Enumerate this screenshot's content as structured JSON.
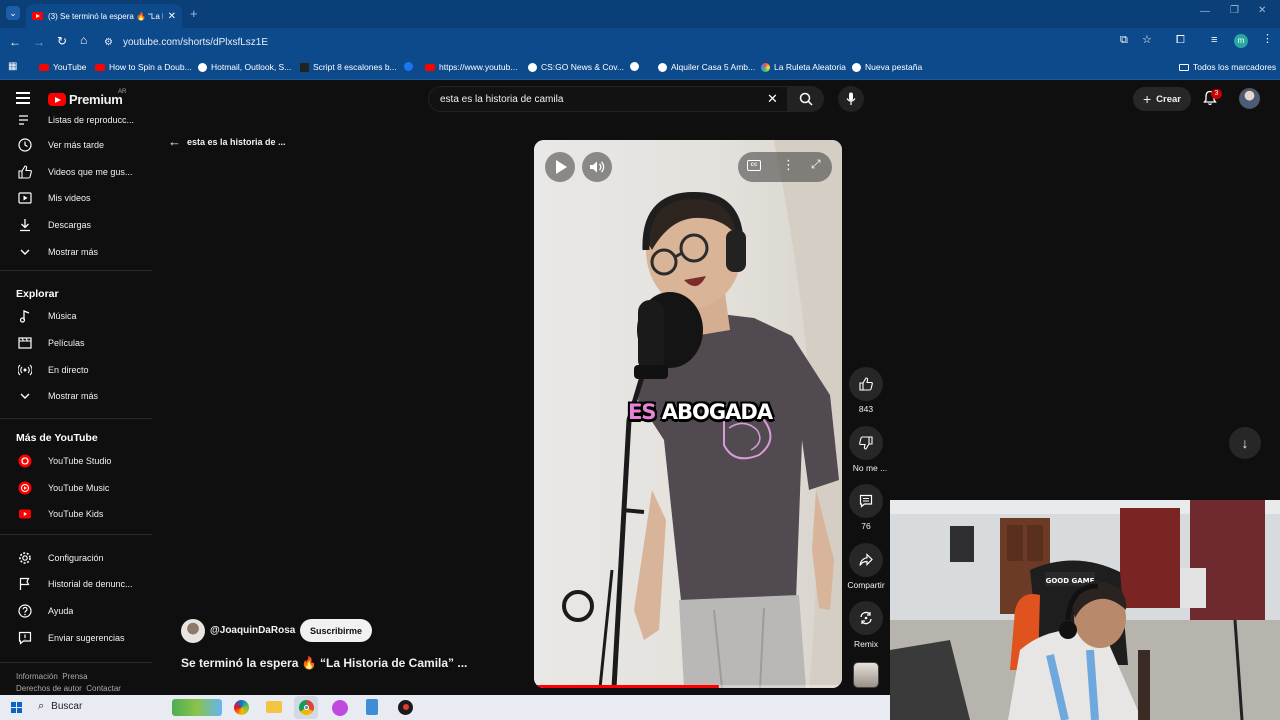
{
  "browser": {
    "tab_title": "(3) Se terminó la espera 🔥 “La H",
    "url": "youtube.com/shorts/dPlxsfLsz1E",
    "bookmarks": [
      {
        "label": "YouTube",
        "icon": "youtube-icon"
      },
      {
        "label": "How to Spin a Doub...",
        "icon": "youtube-icon"
      },
      {
        "label": "Hotmail, Outlook, S...",
        "icon": "globe-icon"
      },
      {
        "label": "Script 8 escalones b...",
        "icon": "site-icon"
      },
      {
        "label": "",
        "icon": "facebook-icon"
      },
      {
        "label": "https://www.youtub...",
        "icon": "youtube-icon"
      },
      {
        "label": "CS:GO News & Cov...",
        "icon": "globe-icon"
      },
      {
        "label": "",
        "icon": "globe-icon"
      },
      {
        "label": "Alquiler Casa 5 Amb...",
        "icon": "globe-icon"
      },
      {
        "label": "La Ruleta Aleatoria",
        "icon": "wheel-icon"
      },
      {
        "label": "Nueva pestaña",
        "icon": "globe-icon"
      }
    ],
    "all_bookmarks": "Todos los marcadores",
    "profile_initial": "m"
  },
  "header": {
    "logo": "Premium",
    "logo_country": "AR",
    "search_query": "esta es la historia de camila",
    "create_label": "Crear",
    "notification_count": "3"
  },
  "sidebar": {
    "top_items": [
      {
        "label": "Listas de reproducc...",
        "icon": "playlist-icon"
      },
      {
        "label": "Ver más tarde",
        "icon": "clock-icon"
      },
      {
        "label": "Videos que me gus...",
        "icon": "thumbs-up-icon"
      },
      {
        "label": "Mis videos",
        "icon": "video-icon"
      },
      {
        "label": "Descargas",
        "icon": "download-icon"
      },
      {
        "label": "Mostrar más",
        "icon": "chevron-down-icon"
      }
    ],
    "explore_heading": "Explorar",
    "explore_items": [
      {
        "label": "Música",
        "icon": "music-icon"
      },
      {
        "label": "Películas",
        "icon": "film-icon"
      },
      {
        "label": "En directo",
        "icon": "live-icon"
      },
      {
        "label": "Mostrar más",
        "icon": "chevron-down-icon"
      }
    ],
    "more_heading": "Más de YouTube",
    "more_items": [
      {
        "label": "YouTube Studio",
        "icon": "youtube-studio-icon"
      },
      {
        "label": "YouTube Music",
        "icon": "youtube-music-icon"
      },
      {
        "label": "YouTube Kids",
        "icon": "youtube-kids-icon"
      }
    ],
    "settings_items": [
      {
        "label": "Configuración",
        "icon": "gear-icon"
      },
      {
        "label": "Historial de denunc...",
        "icon": "flag-icon"
      },
      {
        "label": "Ayuda",
        "icon": "help-icon"
      },
      {
        "label": "Enviar sugerencias",
        "icon": "feedback-icon"
      }
    ],
    "footer_line1": [
      "Información",
      "Prensa"
    ],
    "footer_line2": [
      "Derechos de autor",
      "Contactar"
    ]
  },
  "shorts": {
    "back_title": "esta es la historia de ...",
    "caption_word1": "ES",
    "caption_word2": "ABOGADA",
    "channel": "@JoaquinDaRosa",
    "subscribe_label": "Suscribirme",
    "video_title": "Se terminó la espera 🔥 “La Historia de Camila” ...",
    "progress_fraction": 0.6,
    "likes": "843",
    "dislike_label": "No me ...",
    "comments": "76",
    "share_label": "Compartir",
    "remix_label": "Remix"
  },
  "taskbar": {
    "search_label": "Buscar"
  },
  "webcam": {
    "chair_label": "GOOD GAME"
  },
  "colors": {
    "youtube_red": "#ff0000",
    "browser_blue": "#0d4a8c",
    "caption_pink": "#e983d8"
  }
}
